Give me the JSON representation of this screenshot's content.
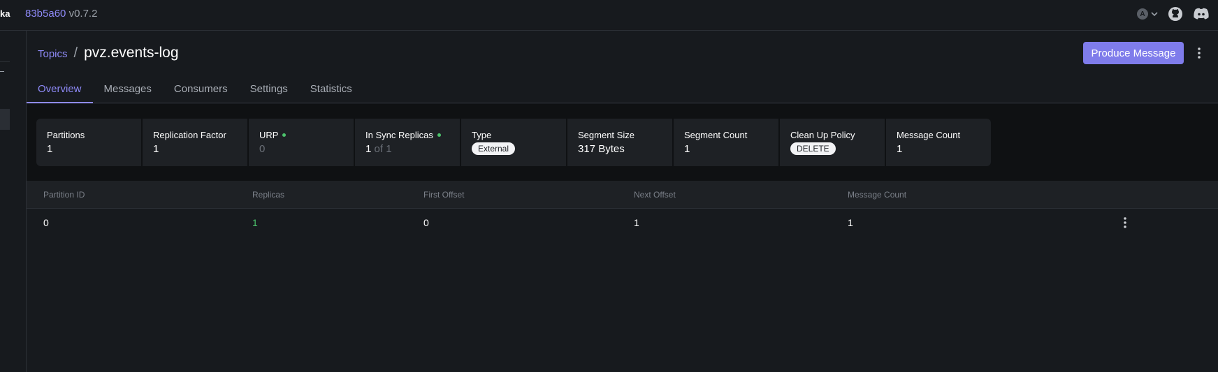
{
  "header": {
    "brand_fragment": "ka",
    "commit_hash": "83b5a60",
    "version": "v0.7.2",
    "avatar_letter": "A"
  },
  "breadcrumb": {
    "parent": "Topics",
    "separator": "/",
    "title": "pvz.events-log"
  },
  "actions": {
    "produce_label": "Produce Message"
  },
  "tabs": [
    {
      "label": "Overview",
      "active": true
    },
    {
      "label": "Messages"
    },
    {
      "label": "Consumers"
    },
    {
      "label": "Settings"
    },
    {
      "label": "Statistics"
    }
  ],
  "stats": {
    "partitions": {
      "label": "Partitions",
      "value": "1"
    },
    "replication_factor": {
      "label": "Replication Factor",
      "value": "1"
    },
    "urp": {
      "label": "URP",
      "value": "0"
    },
    "in_sync_replicas": {
      "label": "In Sync Replicas",
      "value": "1",
      "suffix": "of 1"
    },
    "type": {
      "label": "Type",
      "value": "External"
    },
    "segment_size": {
      "label": "Segment Size",
      "value": "317 Bytes"
    },
    "segment_count": {
      "label": "Segment Count",
      "value": "1"
    },
    "cleanup_policy": {
      "label": "Clean Up Policy",
      "value": "DELETE"
    },
    "message_count": {
      "label": "Message Count",
      "value": "1"
    }
  },
  "table": {
    "columns": [
      "Partition ID",
      "Replicas",
      "First Offset",
      "Next Offset",
      "Message Count"
    ],
    "rows": [
      [
        "0",
        "1",
        "0",
        "1",
        "1"
      ]
    ]
  },
  "colors": {
    "accent": "#7f7ceb",
    "link": "#8e8af7",
    "success": "#4cc36c",
    "background": "#171a1e"
  }
}
